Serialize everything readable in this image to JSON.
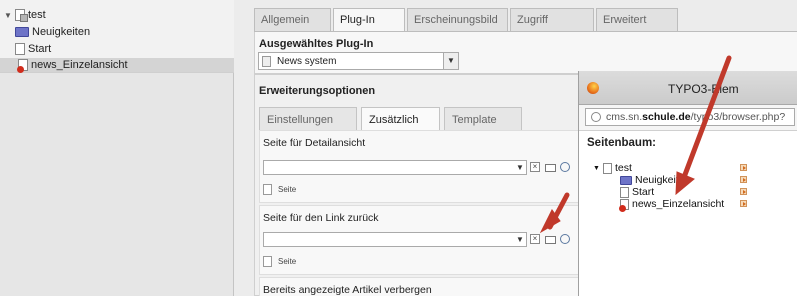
{
  "tree": {
    "root": "test",
    "items": [
      "Neuigkeiten",
      "Start",
      "news_Einzelansicht"
    ]
  },
  "main": {
    "tabs": [
      "Allgemein",
      "Plug-In",
      "Erscheinungsbild",
      "Zugriff",
      "Erweitert"
    ],
    "active_tab": "Plug-In",
    "plugin_section_title": "Ausgewähltes Plug-In",
    "plugin_select_value": "News system",
    "ext_section_title": "Erweiterungsoptionen",
    "subtabs": [
      "Einstellungen",
      "Zusätzlich",
      "Template"
    ],
    "active_subtab": "Zusätzlich",
    "field1_label": "Seite für Detailansicht",
    "field1_seite": "Seite",
    "field2_label": "Seite für den Link zurück",
    "field2_seite": "Seite",
    "field3_label": "Bereits angezeigte Artikel verbergen"
  },
  "popup": {
    "title": "TYPO3-Elem",
    "url_prefix": "cms.sn.",
    "url_bold": "schule.de",
    "url_suffix": "/typo3/browser.php?",
    "tree_heading": "Seitenbaum:",
    "tree_root": "test",
    "tree_items": [
      "Neuigkeiten",
      "Start",
      "news_Einzelansicht"
    ]
  },
  "colors": {
    "annotation_arrow": "#c0392b",
    "folder": "#6e74c8",
    "accent_orange": "#d26a1e"
  }
}
